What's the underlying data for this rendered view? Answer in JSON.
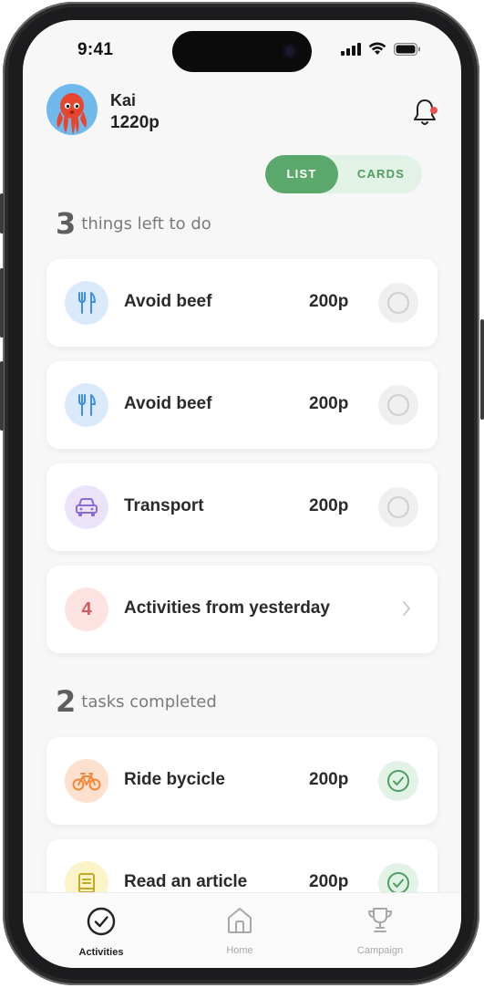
{
  "status_bar": {
    "time": "9:41"
  },
  "user": {
    "name": "Kai",
    "points": "1220p"
  },
  "view_toggle": {
    "list_label": "LIST",
    "cards_label": "CARDS",
    "selected": "LIST"
  },
  "todo_section": {
    "count": "3",
    "label": "things left to do"
  },
  "todo_items": [
    {
      "label": "Avoid beef",
      "points": "200p",
      "icon": "fork-knife-icon",
      "color": "#dbeafb"
    },
    {
      "label": "Avoid beef",
      "points": "200p",
      "icon": "fork-knife-icon",
      "color": "#dbeafb"
    },
    {
      "label": "Transport",
      "points": "200p",
      "icon": "car-icon",
      "color": "#ebe3fa"
    }
  ],
  "yesterday_item": {
    "count": "4",
    "label": "Activities from yesterday"
  },
  "completed_section": {
    "count": "2",
    "label": "tasks completed"
  },
  "completed_items": [
    {
      "label": "Ride bycicle",
      "points": "200p",
      "icon": "bicycle-icon",
      "color": "#fde0cd"
    },
    {
      "label": "Read an article",
      "points": "200p",
      "icon": "book-icon",
      "color": "#fbf4c8"
    }
  ],
  "tabbar": {
    "activities": "Activities",
    "home": "Home",
    "campaign": "Campaign",
    "selected": "Activities"
  },
  "colors": {
    "accent_green": "#5aa86c",
    "notification_red": "#e9534b"
  }
}
